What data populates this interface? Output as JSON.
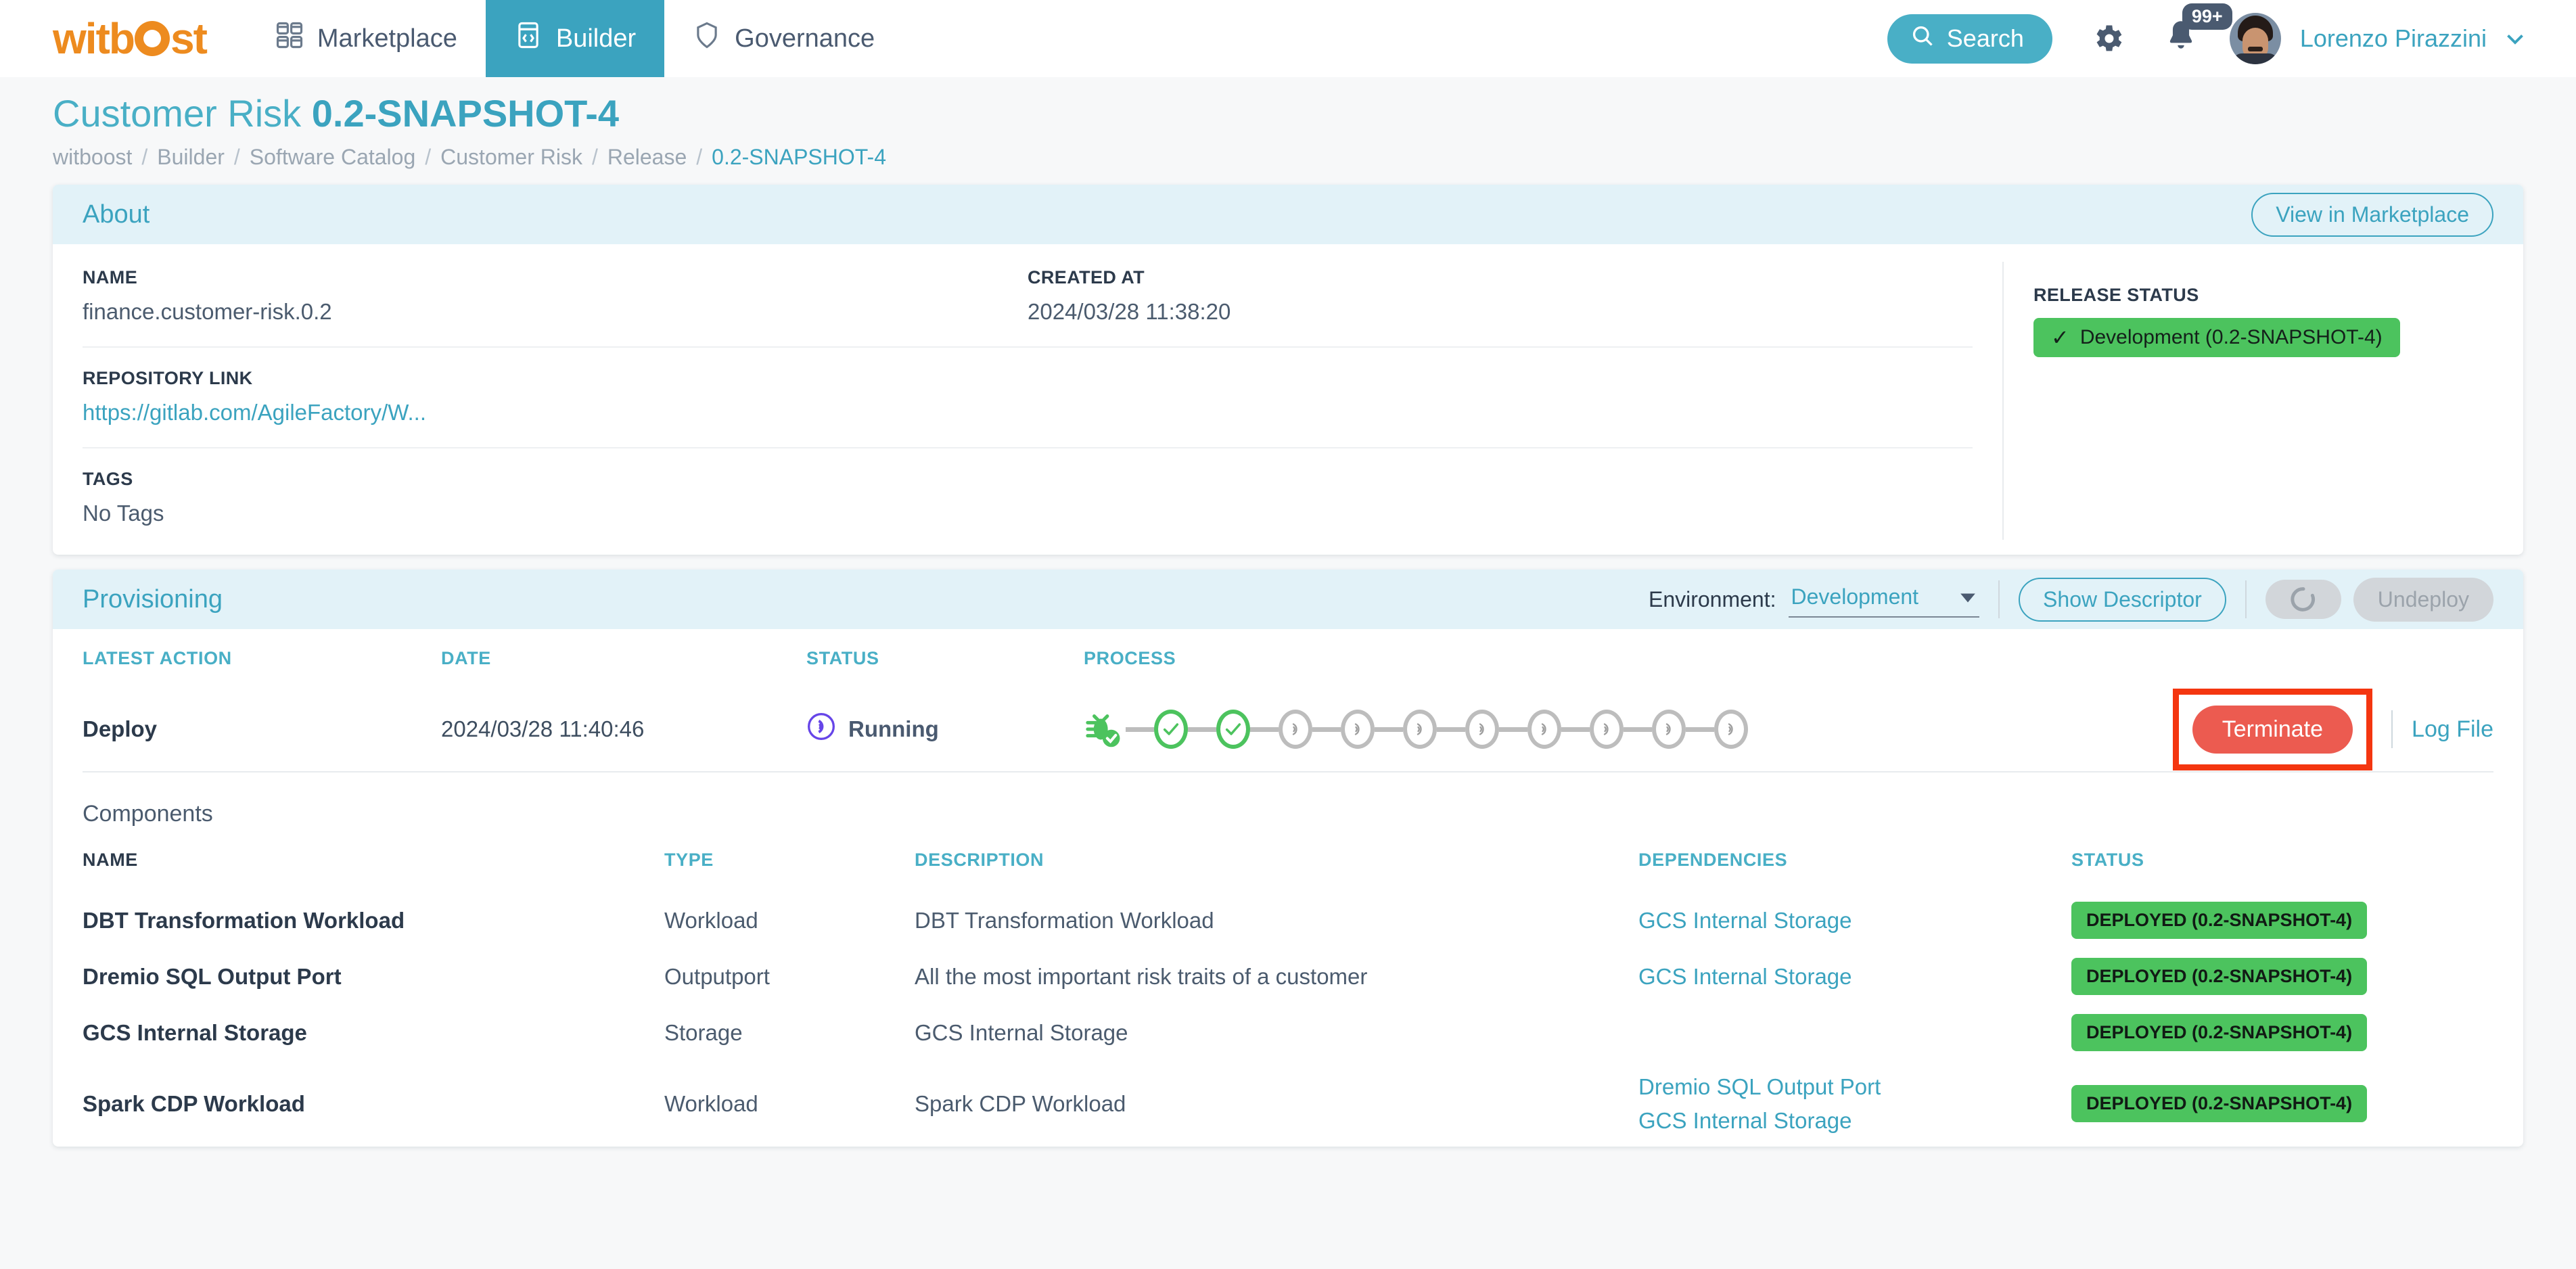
{
  "nav": {
    "logo_text_a": "witb",
    "logo_text_b": "st",
    "tabs": [
      {
        "label": "Marketplace",
        "icon": "grid-icon",
        "active": false
      },
      {
        "label": "Builder",
        "icon": "code-window-icon",
        "active": true
      },
      {
        "label": "Governance",
        "icon": "shield-icon",
        "active": false
      }
    ],
    "search_label": "Search",
    "notification_count": "99+",
    "user_name": "Lorenzo Pirazzini"
  },
  "page": {
    "title_main": "Customer Risk",
    "title_version": "0.2-SNAPSHOT-4",
    "breadcrumb": [
      {
        "label": "witboost",
        "current": false
      },
      {
        "label": "Builder",
        "current": false
      },
      {
        "label": "Software Catalog",
        "current": false
      },
      {
        "label": "Customer Risk",
        "current": false
      },
      {
        "label": "Release",
        "current": false
      },
      {
        "label": "0.2-SNAPSHOT-4",
        "current": true
      }
    ],
    "breadcrumb_separator": "/"
  },
  "about": {
    "title": "About",
    "view_marketplace_label": "View in Marketplace",
    "name_label": "NAME",
    "name_value": "finance.customer-risk.0.2",
    "created_label": "CREATED AT",
    "created_value": "2024/03/28 11:38:20",
    "repo_label": "REPOSITORY LINK",
    "repo_value": "https://gitlab.com/AgileFactory/W...",
    "tags_label": "TAGS",
    "tags_value": "No Tags",
    "release_status_label": "RELEASE STATUS",
    "release_status_value": "Development (0.2-SNAPSHOT-4)",
    "release_status_color": "#4CC35E"
  },
  "provisioning": {
    "title": "Provisioning",
    "environment_label": "Environment:",
    "environment_value": "Development",
    "show_descriptor_label": "Show Descriptor",
    "undeploy_label": "Undeploy",
    "columns": {
      "action": "LATEST ACTION",
      "date": "DATE",
      "status": "STATUS",
      "process": "PROCESS"
    },
    "row": {
      "action": "Deploy",
      "date": "2024/03/28 11:40:46",
      "status": "Running",
      "status_color": "#6645E8"
    },
    "process_steps": [
      {
        "state": "bug-done"
      },
      {
        "state": "done"
      },
      {
        "state": "done"
      },
      {
        "state": "pending"
      },
      {
        "state": "pending"
      },
      {
        "state": "pending"
      },
      {
        "state": "pending"
      },
      {
        "state": "pending"
      },
      {
        "state": "pending"
      },
      {
        "state": "pending"
      },
      {
        "state": "pending"
      }
    ],
    "terminate_label": "Terminate",
    "log_file_label": "Log File",
    "highlight_color": "#F43610"
  },
  "components": {
    "section_label": "Components",
    "columns": {
      "name": "NAME",
      "type": "TYPE",
      "description": "DESCRIPTION",
      "dependencies": "DEPENDENCIES",
      "status": "STATUS"
    },
    "rows": [
      {
        "name": "DBT Transformation Workload",
        "type": "Workload",
        "description": "DBT Transformation Workload",
        "dependencies": [
          "GCS Internal Storage"
        ],
        "status": "DEPLOYED (0.2-SNAPSHOT-4)"
      },
      {
        "name": "Dremio SQL Output Port",
        "type": "Outputport",
        "description": "All the most important risk traits of a customer",
        "dependencies": [
          "GCS Internal Storage"
        ],
        "status": "DEPLOYED (0.2-SNAPSHOT-4)"
      },
      {
        "name": "GCS Internal Storage",
        "type": "Storage",
        "description": "GCS Internal Storage",
        "dependencies": [],
        "status": "DEPLOYED (0.2-SNAPSHOT-4)"
      },
      {
        "name": "Spark CDP Workload",
        "type": "Workload",
        "description": "Spark CDP Workload",
        "dependencies": [
          "Dremio SQL Output Port",
          "GCS Internal Storage"
        ],
        "status": "DEPLOYED (0.2-SNAPSHOT-4)"
      }
    ]
  }
}
